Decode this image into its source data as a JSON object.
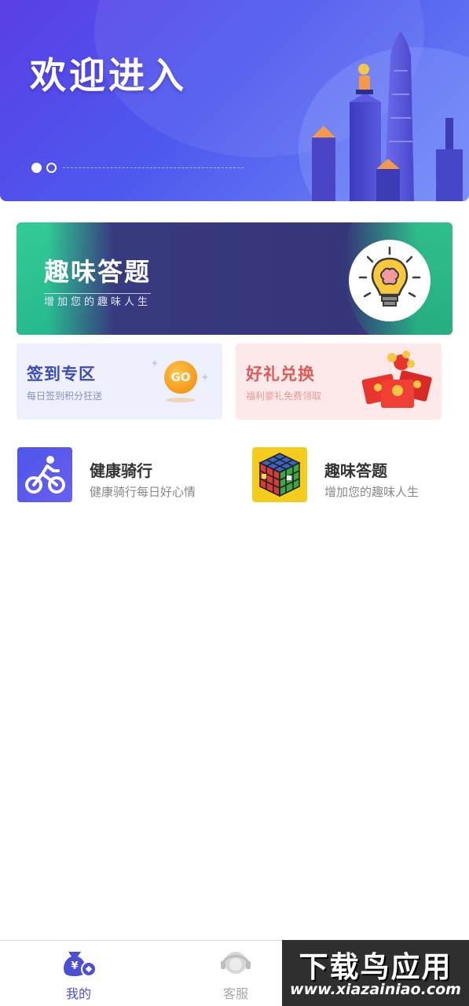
{
  "banner": {
    "title": "欢迎进入",
    "slides": 2,
    "active_slide": 1
  },
  "quiz_card": {
    "title": "趣味答题",
    "subtitle": "增加您的趣味人生"
  },
  "tiles": {
    "sign": {
      "title": "签到专区",
      "subtitle": "每日签到积分狂送",
      "badge": "GO"
    },
    "gift": {
      "title": "好礼兑换",
      "subtitle": "福利豪礼免费领取"
    }
  },
  "items": [
    {
      "title": "健康骑行",
      "subtitle": "健康骑行每日好心情",
      "icon": "bicycle-icon"
    },
    {
      "title": "趣味答题",
      "subtitle": "增加您的趣味人生",
      "icon": "rubiks-cube-icon"
    }
  ],
  "nav": {
    "mine": {
      "label": "我的",
      "icon": "money-bag-icon"
    },
    "service": {
      "label": "客服",
      "icon": "customer-service-icon"
    }
  },
  "watermark": {
    "main": "下载鸟应用",
    "url": "www.xiazainiao.com"
  },
  "colors": {
    "banner": "#5049e8",
    "accent": "#4b4fd6",
    "quiz_bg": "#36367b",
    "quiz_green": "#2fbf8f",
    "sign_title": "#3b4bb6",
    "gift_title": "#e05a5a"
  }
}
